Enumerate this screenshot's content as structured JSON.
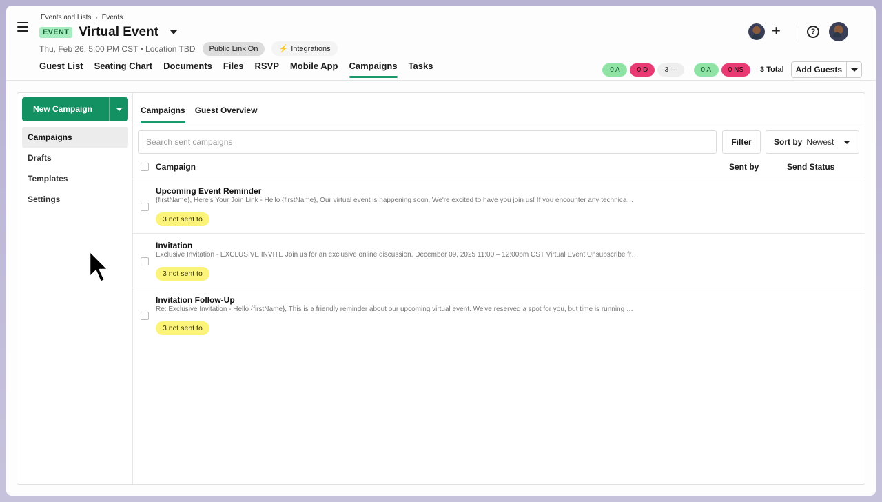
{
  "breadcrumb": {
    "parent": "Events and Lists",
    "separator": "›",
    "current": "Events"
  },
  "event": {
    "badge": "EVENT",
    "title": "Virtual Event",
    "meta": "Thu, Feb 26, 5:00 PM CST • Location TBD",
    "public_link": "Public Link On",
    "integrations": "Integrations"
  },
  "nav_tabs": [
    "Guest List",
    "Seating Chart",
    "Documents",
    "Files",
    "RSVP",
    "Mobile App",
    "Campaigns",
    "Tasks"
  ],
  "active_nav_tab": "Campaigns",
  "header_icons": {
    "plus": "+",
    "help": "?"
  },
  "stats": {
    "attending_1": "0 A",
    "declined": "0 D",
    "pending": "3 —",
    "attending_2": "0 A",
    "no_show": "0 NS",
    "total": "3 Total"
  },
  "add_guests_label": "Add Guests",
  "sidebar": {
    "new_campaign_label": "New Campaign",
    "items": [
      "Campaigns",
      "Drafts",
      "Templates",
      "Settings"
    ],
    "active": "Campaigns"
  },
  "sub_tabs": [
    "Campaigns",
    "Guest Overview"
  ],
  "search": {
    "placeholder": "Search sent campaigns",
    "value": ""
  },
  "filter_label": "Filter",
  "sort": {
    "label": "Sort by",
    "value": "Newest"
  },
  "table": {
    "headers": {
      "campaign": "Campaign",
      "sent_by": "Sent by",
      "send_status": "Send Status"
    },
    "rows": [
      {
        "name": "Upcoming Event Reminder",
        "preview": "{firstName}, Here's Your Join Link - Hello {firstName}, Our virtual event is happening soon. We're excited to have you join us! If you encounter any technica…",
        "tag": "3 not sent to"
      },
      {
        "name": "Invitation",
        "preview": "Exclusive Invitation - EXCLUSIVE INVITE Join us for an exclusive online discussion. December 09, 2025 11:00 – 12:00pm CST Virtual Event Unsubscribe fr…",
        "tag": "3 not sent to"
      },
      {
        "name": "Invitation Follow-Up",
        "preview": "Re: Exclusive Invitation - Hello {firstName}, This is a friendly reminder about our upcoming virtual event. We've reserved a spot for you, but time is running …",
        "tag": "3 not sent to"
      }
    ]
  },
  "colors": {
    "accent_green": "#149162",
    "tab_underline": "#1a9a6b",
    "stat_green": "#8ee3a5",
    "stat_red": "#ea3a73",
    "tag_yellow": "#fbf37a",
    "event_badge": "#a6eec0"
  },
  "icons": [
    "hamburger-menu-icon",
    "chevron-down-icon",
    "bolt-icon",
    "plus-icon",
    "help-icon",
    "avatar",
    "mouse-pointer"
  ]
}
